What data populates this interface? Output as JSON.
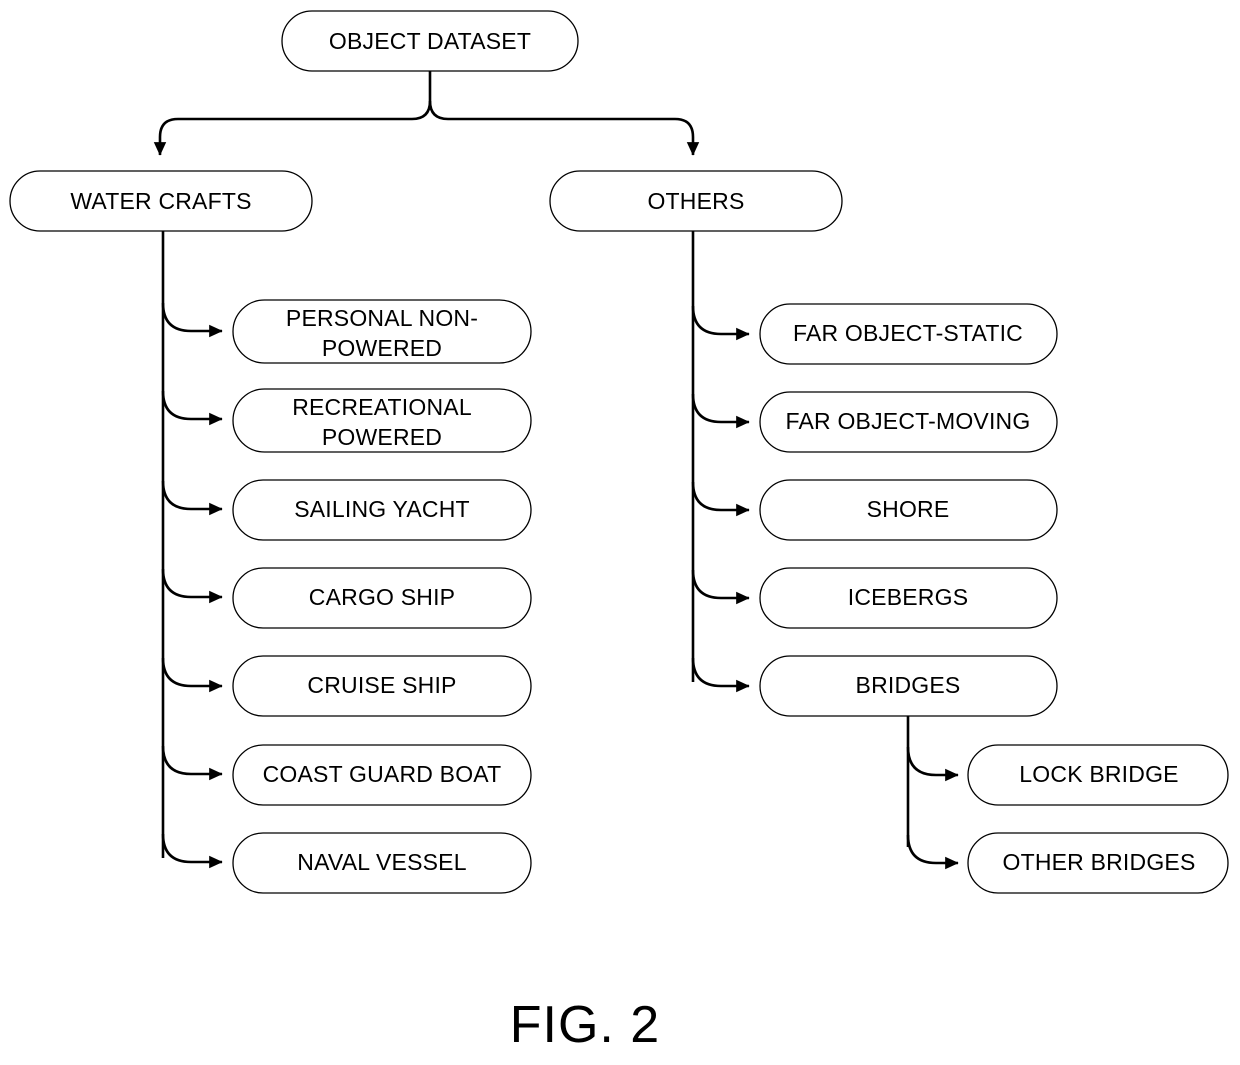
{
  "figure": {
    "caption": "FIG. 2",
    "type": "hierarchy-tree-diagram"
  },
  "tree": {
    "root": {
      "id": "object-dataset",
      "label": "OBJECT DATASET"
    },
    "level2": [
      {
        "id": "water-crafts",
        "label": "WATER CRAFTS"
      },
      {
        "id": "others",
        "label": "OTHERS"
      }
    ],
    "water_crafts_children": [
      {
        "id": "personal-non-powered",
        "label_line1": "PERSONAL NON-",
        "label_line2": "POWERED"
      },
      {
        "id": "recreational-powered",
        "label_line1": "RECREATIONAL",
        "label_line2": "POWERED"
      },
      {
        "id": "sailing-yacht",
        "label_line1": "SAILING YACHT",
        "label_line2": ""
      },
      {
        "id": "cargo-ship",
        "label_line1": "CARGO SHIP",
        "label_line2": ""
      },
      {
        "id": "cruise-ship",
        "label_line1": "CRUISE SHIP",
        "label_line2": ""
      },
      {
        "id": "coast-guard-boat",
        "label_line1": "COAST GUARD BOAT",
        "label_line2": ""
      },
      {
        "id": "naval-vessel",
        "label_line1": "NAVAL VESSEL",
        "label_line2": ""
      }
    ],
    "others_children": [
      {
        "id": "far-object-static",
        "label": "FAR OBJECT-STATIC"
      },
      {
        "id": "far-object-moving",
        "label": "FAR OBJECT-MOVING"
      },
      {
        "id": "shore",
        "label": "SHORE"
      },
      {
        "id": "icebergs",
        "label": "ICEBERGS"
      },
      {
        "id": "bridges",
        "label": "BRIDGES"
      }
    ],
    "bridges_children": [
      {
        "id": "lock-bridge",
        "label": "LOCK BRIDGE"
      },
      {
        "id": "other-bridges",
        "label": "OTHER BRIDGES"
      }
    ]
  },
  "colors": {
    "stroke": "#000000",
    "fill": "#ffffff",
    "text": "#000000"
  }
}
